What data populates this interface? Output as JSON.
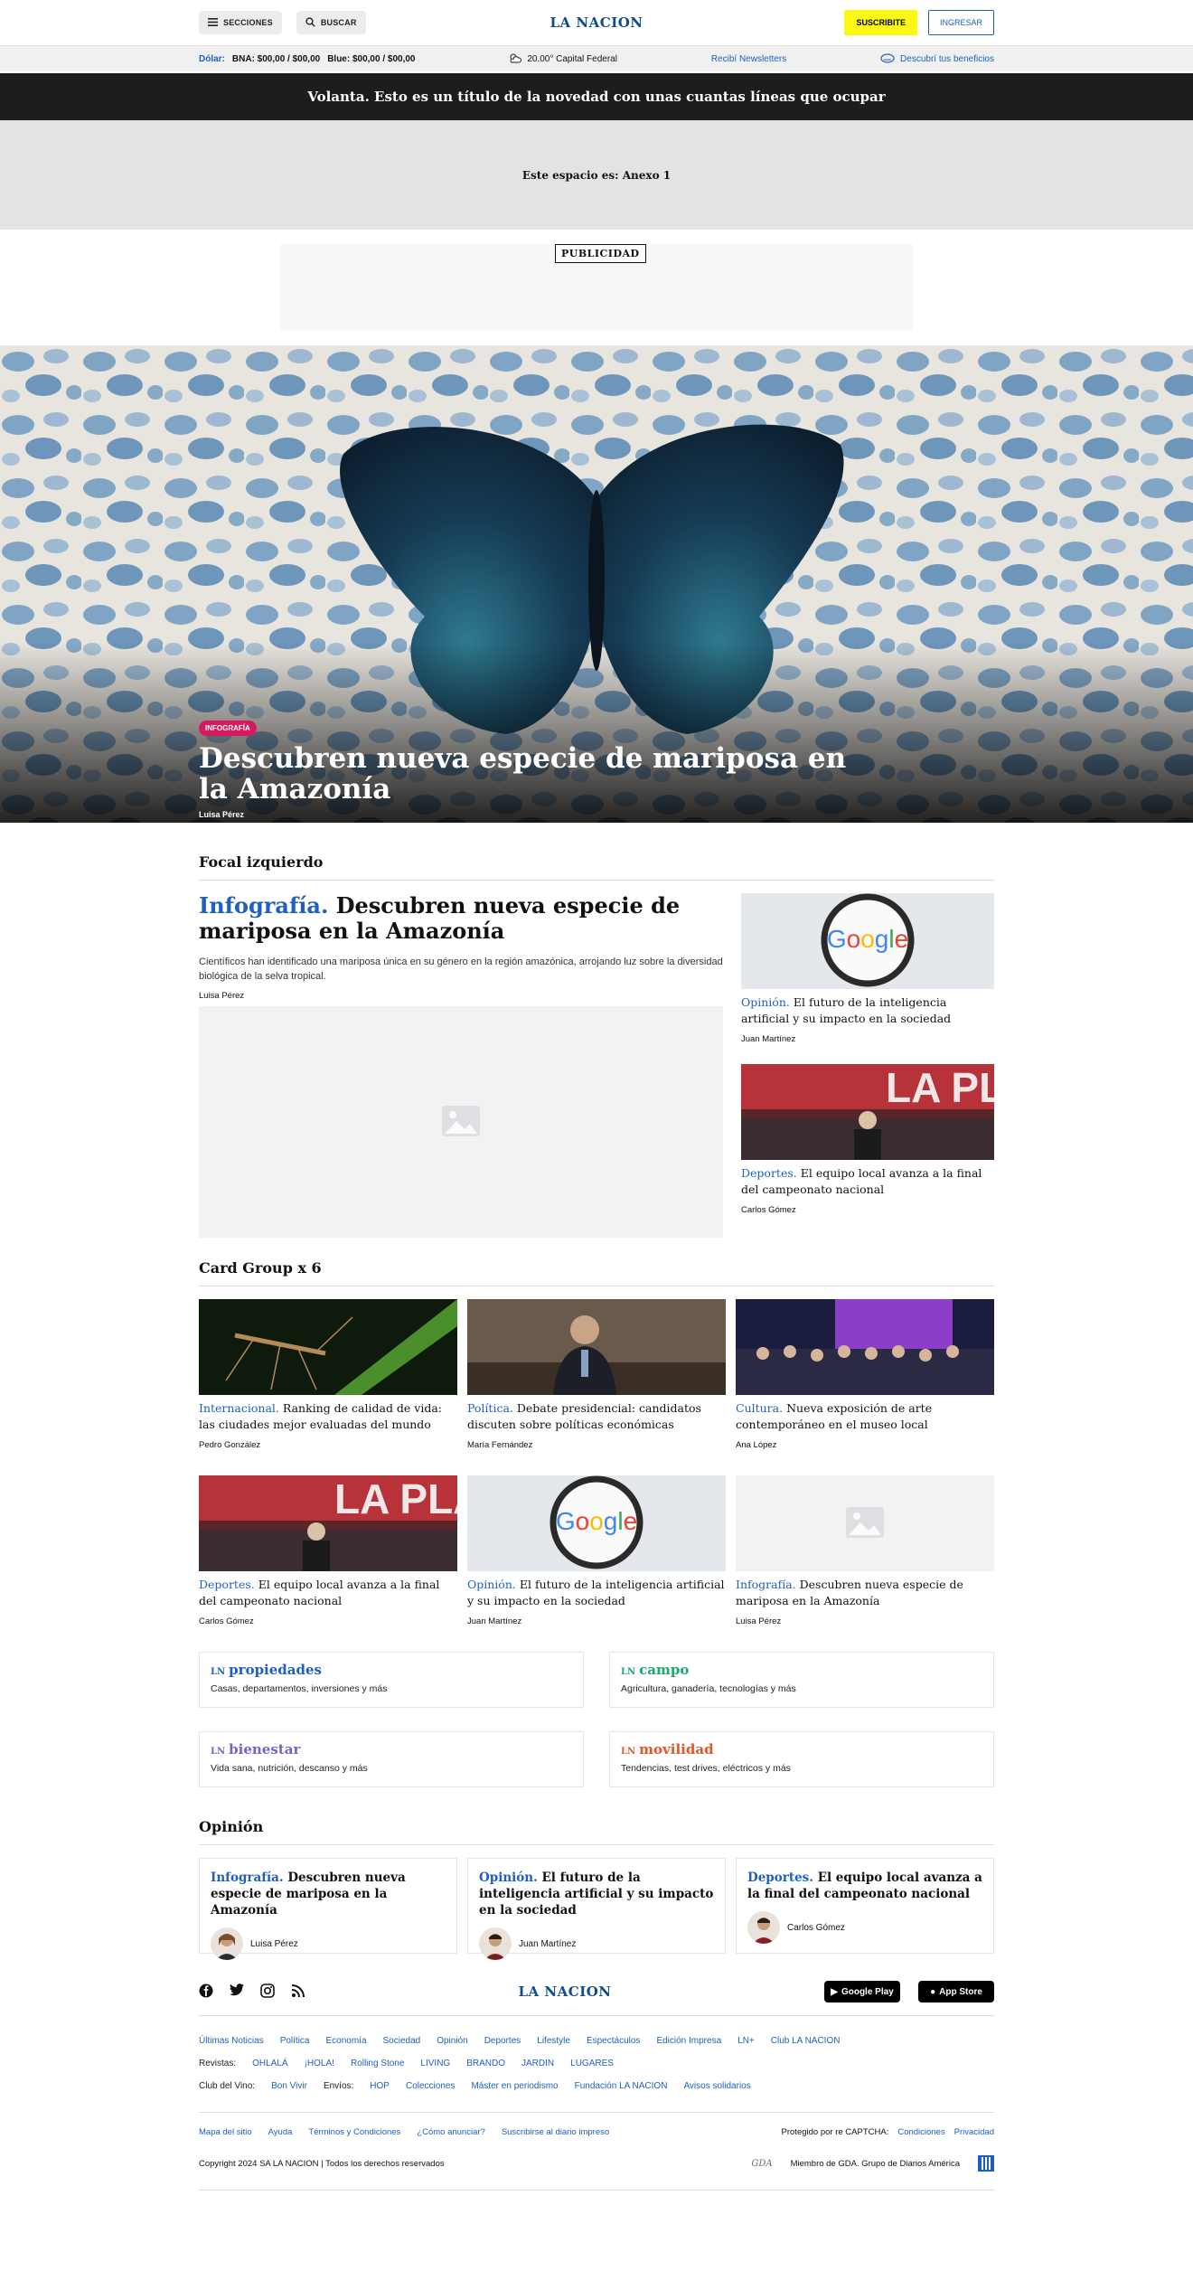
{
  "header": {
    "sections_label": "SECCIONES",
    "search_label": "BUSCAR",
    "logo": "LA NACION",
    "subscribe_label": "SUSCRIBITE",
    "login_label": "INGRESAR"
  },
  "infobar": {
    "dolar_label": "Dólar:",
    "bna": "BNA: $00,00 / $00,00",
    "blue": "Blue: $00,00 / $00,00",
    "weather": "20.00° Capital Federal",
    "newsletters": "Recibí Newsletters",
    "benefits": "Descubrí tus beneficios"
  },
  "volanta": "Volanta. Esto es un título de la novedad con unas cuantas líneas que ocupar",
  "anexo": "Este espacio es: Anexo 1",
  "ad_label": "PUBLICIDAD",
  "hero": {
    "tag": "INFOGRAFÍA",
    "title": "Descubren nueva especie de mariposa en la Amazonía",
    "author": "Luisa Pérez"
  },
  "focal": {
    "section_title": "Focal izquierdo",
    "main": {
      "kicker": "Infografía.",
      "title": "Descubren nueva especie de mariposa en la Amazonía",
      "summary": "Científicos han identificado una mariposa única en su género en la región amazónica, arrojando luz sobre la diversidad biológica de la selva tropical.",
      "author": "Luisa Pérez"
    },
    "side": [
      {
        "kicker": "Opinión.",
        "title": "El futuro de la inteligencia artificial y su impacto en la sociedad",
        "author": "Juan Martínez"
      },
      {
        "kicker": "Deportes.",
        "title": "El equipo local avanza a la final del campeonato nacional",
        "author": "Carlos Gómez"
      }
    ]
  },
  "card_group": {
    "section_title": "Card Group x 6",
    "cards": [
      {
        "kicker": "Internacional.",
        "title": "Ranking de calidad de vida: las ciudades mejor evaluadas del mundo",
        "author": "Pedro González"
      },
      {
        "kicker": "Política.",
        "title": "Debate presidencial: candidatos discuten sobre políticas económicas",
        "author": "María Fernández"
      },
      {
        "kicker": "Cultura.",
        "title": "Nueva exposición de arte contemporáneo en el museo local",
        "author": "Ana López"
      },
      {
        "kicker": "Deportes.",
        "title": "El equipo local avanza a la final del campeonato nacional",
        "author": "Carlos Gómez"
      },
      {
        "kicker": "Opinión.",
        "title": "El futuro de la inteligencia artificial y su impacto en la sociedad",
        "author": "Juan Martínez"
      },
      {
        "kicker": "Infografía.",
        "title": "Descubren nueva especie de mariposa en la Amazonía",
        "author": "Luisa Pérez"
      }
    ]
  },
  "brands": [
    {
      "prefix": "LN",
      "name": "propiedades",
      "desc": "Casas, departamentos, inversiones y más",
      "color": "#1e5fbf"
    },
    {
      "prefix": "LN",
      "name": "campo",
      "desc": "Agricultura, ganadería, tecnologías y más",
      "color": "#18a86b"
    },
    {
      "prefix": "LN",
      "name": "bienestar",
      "desc": "Vida sana, nutrición, descanso y más",
      "color": "#7b5fc7"
    },
    {
      "prefix": "LN",
      "name": "movilidad",
      "desc": "Tendencias, test drives, eléctricos y más",
      "color": "#e2552b"
    }
  ],
  "opinion": {
    "section_title": "Opinión",
    "cards": [
      {
        "kicker": "Infografía.",
        "title": "Descubren nueva especie de mariposa en la Amazonía",
        "author": "Luisa Pérez"
      },
      {
        "kicker": "Opinión.",
        "title": "El futuro de la inteligencia artificial y su impacto en la sociedad",
        "author": "Juan Martínez"
      },
      {
        "kicker": "Deportes.",
        "title": "El equipo local avanza a la final del campeonato nacional",
        "author": "Carlos Gómez"
      }
    ]
  },
  "footer": {
    "logo": "LA NACION",
    "google_play": "Google Play",
    "app_store": "App Store",
    "nav": [
      "Últimas Noticias",
      "Política",
      "Economía",
      "Sociedad",
      "Opinión",
      "Deportes",
      "Lifestyle",
      "Espectáculos",
      "Edición Impresa",
      "LN+",
      "Club LA NACION"
    ],
    "revistas_label": "Revistas:",
    "revistas": [
      "OHLALÁ",
      "¡HOLA!",
      "Rolling Stone",
      "LIVING",
      "BRANDO",
      "JARDIN",
      "LUGARES"
    ],
    "club_label": "Club del Vino:",
    "club": "Bon Vivir",
    "envios_label": "Envíos:",
    "misc": [
      "HOP",
      "Colecciones",
      "Máster en periodismo",
      "Fundación LA NACION",
      "Avisos solidarios"
    ],
    "bottom_links": [
      "Mapa del sitio",
      "Ayuda",
      "Términos y Condiciones",
      "¿Cómo anunciar?",
      "Suscribirse al diario impreso"
    ],
    "captcha": "Protegido por re CAPTCHA:",
    "conditions": "Condiciones",
    "privacy": "Privacidad",
    "copyright": "Copyright 2024 SA LA NACION | Todos los derechos reservados",
    "gda": "Miembro de GDA. Grupo de Diarios América",
    "gda_mark": "GDA"
  }
}
